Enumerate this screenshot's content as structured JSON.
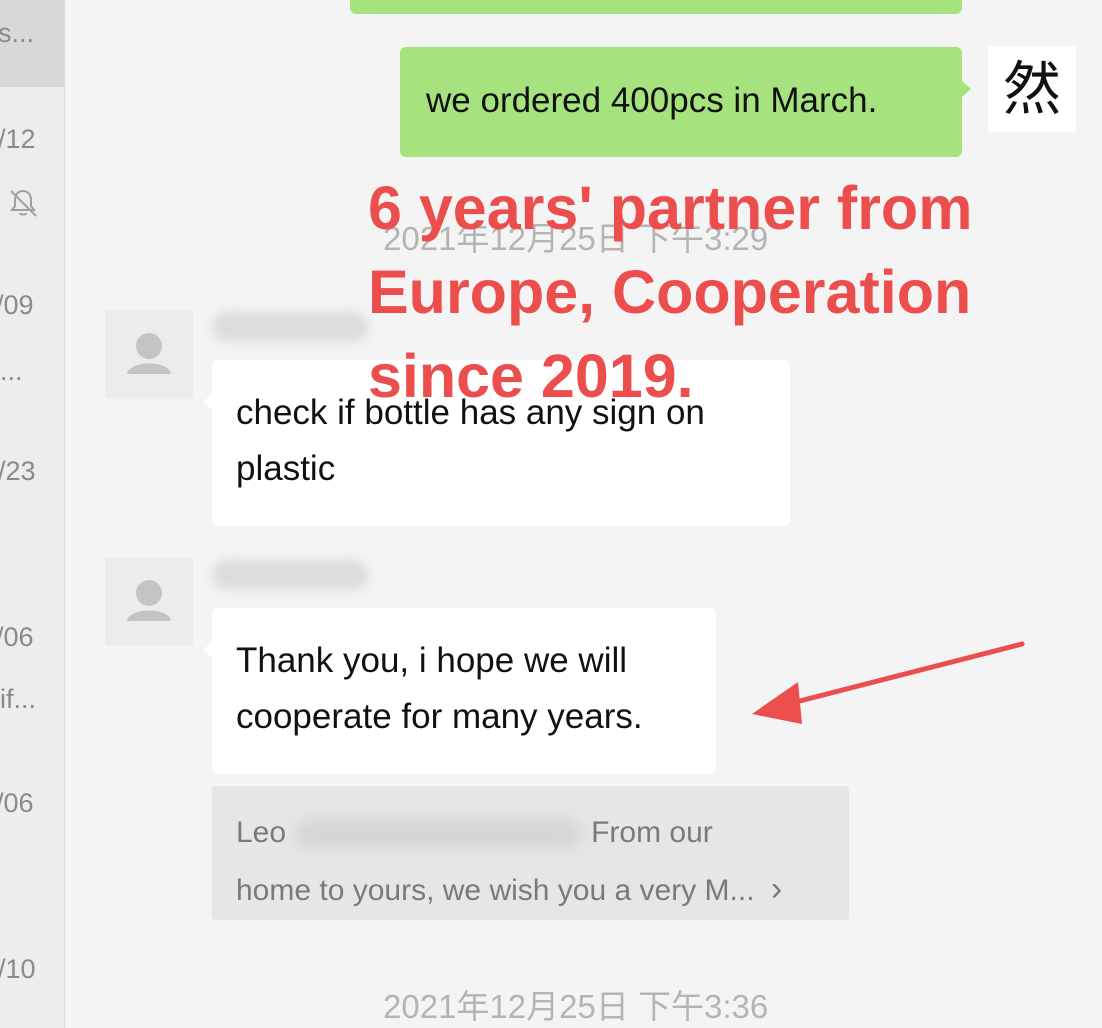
{
  "sidebar": {
    "items": [
      {
        "text": "s..."
      },
      {
        "text": "/12"
      },
      {
        "text": "/09"
      },
      {
        "text": "..."
      },
      {
        "text": "/23"
      },
      {
        "text": "/06"
      },
      {
        "text": "if..."
      },
      {
        "text": "/06"
      },
      {
        "text": "/10"
      }
    ],
    "muted_icon": "bell-muted-icon"
  },
  "messages": [
    {
      "text": "we ordered 400pcs in March."
    },
    {
      "text": "check if bottle has any sign on plastic"
    },
    {
      "text": "Thank you, i hope we will cooperate for many years."
    }
  ],
  "self_avatar": {
    "glyph": "然"
  },
  "timestamps": [
    "2021年12月25日 下午3:29",
    "2021年12月25日 下午3:36"
  ],
  "link_card": {
    "name": "Leo",
    "text_after_name": "From our",
    "line2": "home to yours, we wish you a very M...",
    "chevron": "›"
  },
  "overlay": {
    "lines": [
      "6 years' partner from",
      "Europe, Cooperation",
      "since 2019."
    ],
    "color": "#ec4d4d"
  },
  "colors": {
    "green_bubble": "#a6e37f",
    "white_bubble": "#ffffff",
    "background": "#f4f4f4"
  }
}
